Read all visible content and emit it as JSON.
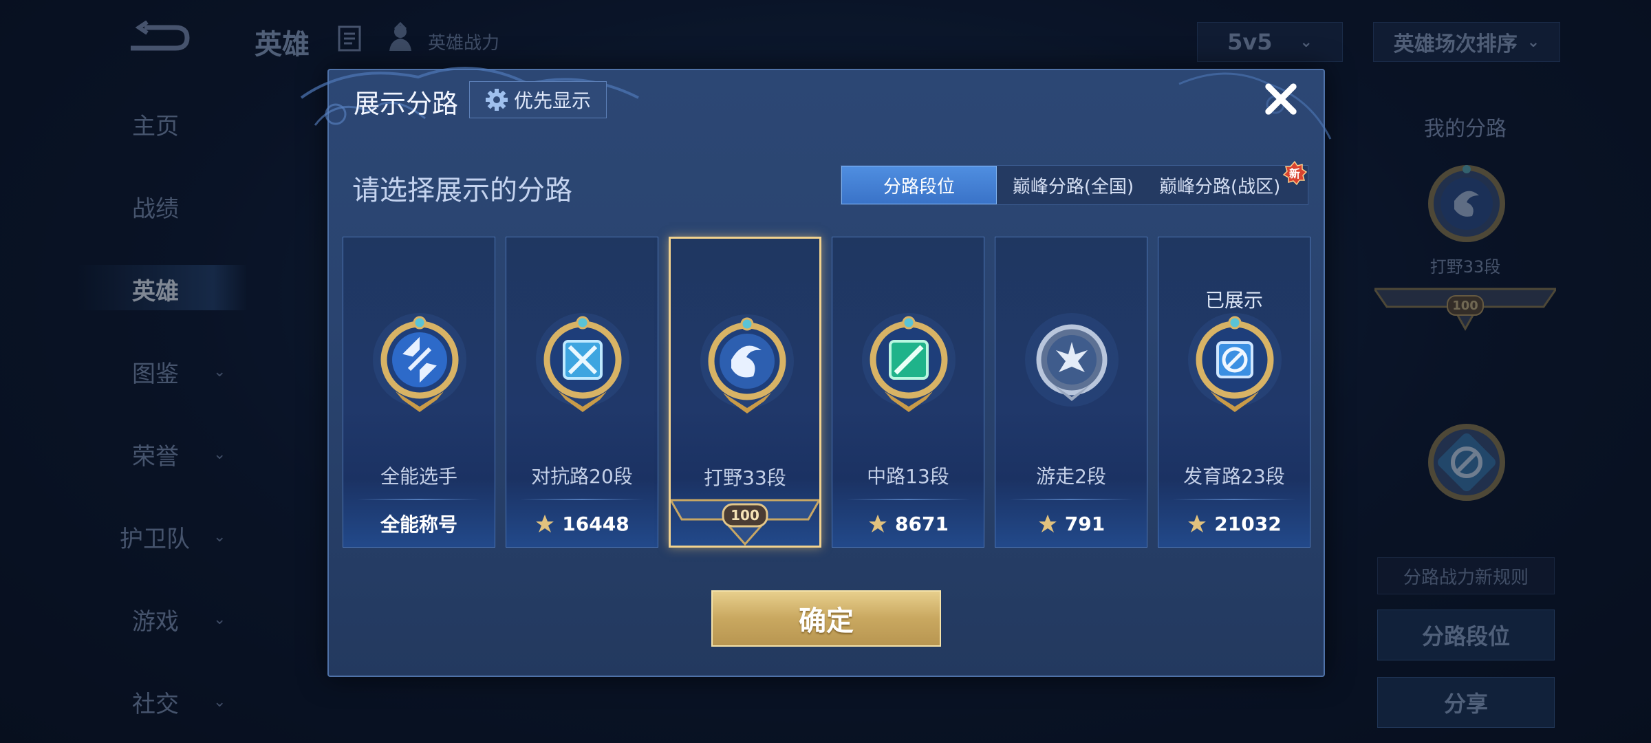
{
  "app": {
    "title": "英雄",
    "power_label": "英雄战力",
    "mode_select": "5v5",
    "sort_select": "英雄场次排序"
  },
  "sidebar": {
    "items": [
      {
        "label": "主页",
        "chevron": false
      },
      {
        "label": "战绩",
        "chevron": false
      },
      {
        "label": "英雄",
        "chevron": false,
        "active": true
      },
      {
        "label": "图鉴",
        "chevron": true
      },
      {
        "label": "荣誉",
        "chevron": true
      },
      {
        "label": "护卫队",
        "chevron": true
      },
      {
        "label": "游戏",
        "chevron": true
      },
      {
        "label": "社交",
        "chevron": true
      }
    ]
  },
  "right_panel": {
    "title": "我的分路",
    "badge_label": "打野33段",
    "plate_number": "100",
    "rule_link": "分路战力新规则",
    "lane_rank_button": "分路段位",
    "share_button": "分享"
  },
  "modal": {
    "title": "展示分路",
    "priority_button": "优先显示",
    "subtitle": "请选择展示的分路",
    "tabs": [
      "分路段位",
      "巅峰分路(全国)",
      "巅峰分路(战区)"
    ],
    "new_badge": "新",
    "confirm": "确定",
    "cards": [
      {
        "name": "全能选手",
        "bottom": "全能称号",
        "type": "allround"
      },
      {
        "name": "对抗路20段",
        "score": "16448",
        "type": "clash"
      },
      {
        "name": "打野33段",
        "plate": "100",
        "type": "jungle",
        "selected": true
      },
      {
        "name": "中路13段",
        "score": "8671",
        "type": "mid"
      },
      {
        "name": "游走2段",
        "score": "791",
        "type": "roam"
      },
      {
        "name": "发育路23段",
        "score": "21032",
        "type": "farm",
        "status": "已展示"
      }
    ]
  },
  "colors": {
    "gold": "#e8c67a",
    "panel_blue": "#2a4470",
    "accent_blue": "#4f8ee0",
    "confirm_gold": "#c9a860"
  }
}
